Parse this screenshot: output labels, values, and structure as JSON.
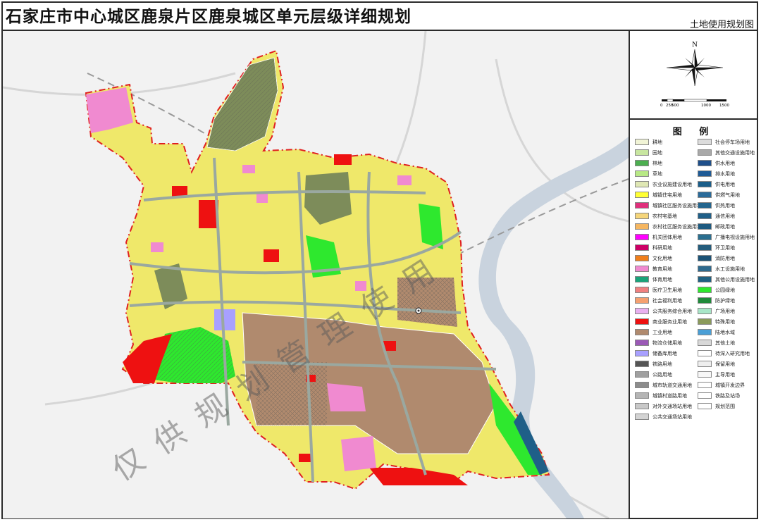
{
  "title": "石家庄市中心城区鹿泉片区鹿泉城区单元层级详细规划",
  "subtitle": "土地使用规划图",
  "compass": {
    "north_label": "N"
  },
  "scale_bar": {
    "labels": [
      "0",
      "250",
      "500",
      "1000",
      "1500"
    ]
  },
  "legend": {
    "title": "图 例",
    "col1": [
      {
        "label": "耕地",
        "color": "#f1f4d6"
      },
      {
        "label": "园地",
        "color": "#c8e6a0"
      },
      {
        "label": "林地",
        "color": "#4caf50"
      },
      {
        "label": "草地",
        "color": "#b8e986"
      },
      {
        "label": "农业设施建设用地",
        "color": "#dfe7b4"
      },
      {
        "label": "城镇住宅用地",
        "color": "#ffff33"
      },
      {
        "label": "城镇社区服务设施用地",
        "color": "#e0307c"
      },
      {
        "label": "农村宅基地",
        "color": "#f5d57a"
      },
      {
        "label": "农村社区服务设施用地",
        "color": "#f5b661"
      },
      {
        "label": "机关团体用地",
        "color": "#ff00ff"
      },
      {
        "label": "科研用地",
        "color": "#cc0066"
      },
      {
        "label": "文化用地",
        "color": "#f07f1b"
      },
      {
        "label": "教育用地",
        "color": "#f08ad0"
      },
      {
        "label": "体育用地",
        "color": "#1aa37a"
      },
      {
        "label": "医疗卫生用地",
        "color": "#f08080"
      },
      {
        "label": "社会福利用地",
        "color": "#f5a070"
      },
      {
        "label": "公共服务综合用地",
        "color": "#e8b0f0"
      },
      {
        "label": "商业服务业用地",
        "color": "#ee1111"
      },
      {
        "label": "工业用地",
        "color": "#b08a6e"
      },
      {
        "label": "物流仓储用地",
        "color": "#9b59b6"
      },
      {
        "label": "储备库用地",
        "color": "#a8a0ff"
      },
      {
        "label": "铁路用地",
        "color": "#555555"
      },
      {
        "label": "公路用地",
        "color": "#a0a0a0"
      },
      {
        "label": "城市轨道交通用地",
        "color": "#8c8c8c"
      },
      {
        "label": "城镇村道路用地",
        "color": "#b5b5b5"
      },
      {
        "label": "对外交通场站用地",
        "color": "#c8c8c8"
      },
      {
        "label": "公共交通场站用地",
        "color": "#d3d3d3"
      }
    ],
    "col2": [
      {
        "label": "社会停车场用地",
        "color": "#dcdcdc"
      },
      {
        "label": "其他交通设施用地",
        "color": "#a9a9a9"
      },
      {
        "label": "供水用地",
        "color": "#1e4f8a"
      },
      {
        "label": "排水用地",
        "color": "#1f5b96"
      },
      {
        "label": "供电用地",
        "color": "#1a5e8a"
      },
      {
        "label": "供燃气用地",
        "color": "#2a6b9a"
      },
      {
        "label": "供热用地",
        "color": "#23658e"
      },
      {
        "label": "通信用地",
        "color": "#1f5f88"
      },
      {
        "label": "邮政用地",
        "color": "#1d5a80"
      },
      {
        "label": "广播电视设施用地",
        "color": "#2a6f90"
      },
      {
        "label": "环卫用地",
        "color": "#245c7c"
      },
      {
        "label": "消防用地",
        "color": "#1b5276"
      },
      {
        "label": "水工设施用地",
        "color": "#2e6a8e"
      },
      {
        "label": "其他公用设施用地",
        "color": "#1f6081"
      },
      {
        "label": "公园绿地",
        "color": "#2ee82e"
      },
      {
        "label": "防护绿地",
        "color": "#1f8a3a"
      },
      {
        "label": "广场用地",
        "color": "#a8e6c8"
      },
      {
        "label": "特殊用地",
        "color": "#8a9a5b"
      },
      {
        "label": "陆地水域",
        "color": "#4a9fd6"
      },
      {
        "label": "其他土地",
        "color": "#d8d8d8"
      },
      {
        "label": "待深入研究用地",
        "color": "#ffffff"
      },
      {
        "label": "保留用地",
        "color": "#eeeeee"
      },
      {
        "label": "主导用地",
        "color": "#f7f7f7"
      },
      {
        "label": "城镇开发边界",
        "color": "#ffffff"
      },
      {
        "label": "铁路及站场",
        "color": "#ffffff"
      },
      {
        "label": "规划范围",
        "color": "#ffffff"
      }
    ]
  },
  "watermark": "仅供规划管理使用"
}
